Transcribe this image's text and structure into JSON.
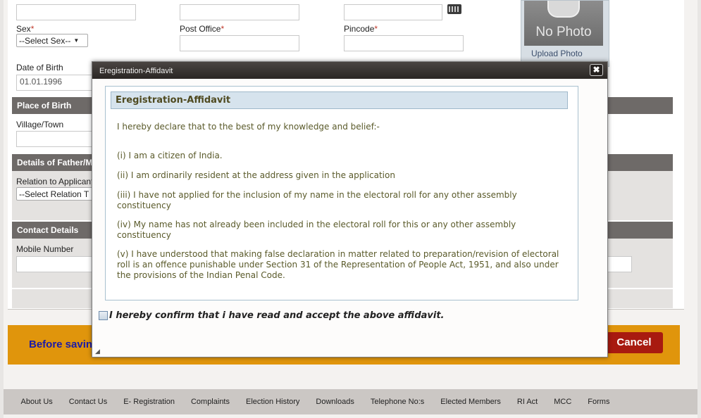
{
  "form": {
    "sex_label": "Sex",
    "sex_select": "--Select Sex--",
    "post_office_label": "Post Office",
    "pincode_label": "Pincode",
    "required_mark": "*",
    "dob_label": "Date of Birth",
    "dob_value": "01.01.1996",
    "place_of_birth_header": "Place of Birth",
    "village_label": "Village/Town",
    "details_father_header": "Details of Father/Mo",
    "relation_label": "Relation to Applicant",
    "relation_select": "--Select Relation T",
    "contact_header": "Contact Details",
    "mobile_label": "Mobile Number"
  },
  "photo": {
    "placeholder": "No Photo",
    "upload_label": "Upload Photo"
  },
  "banner": {
    "before_saving": "Before saving",
    "cancel": "Cancel"
  },
  "dialog": {
    "title": "Eregistration-Affidavit",
    "close": "✖",
    "header": "Eregistration-Affidavit",
    "intro": "I hereby declare that to the best of my knowledge and belief:-",
    "clauses": [
      "(i) I am a citizen of India.",
      "(ii) I am ordinarily resident at the address given in the application",
      "(iii) I have not applied for the inclusion of my name in the electoral roll for any other assembly constituency",
      "(iv) My name has not already been included in the electoral roll for this or any other assembly constituency",
      "(v) I have understood that making false declaration in matter related to preparation/revision of electoral roll is an offence punishable under Section 31 of the Representation of People Act, 1951, and also under the provisions of the Indian Penal Code."
    ],
    "confirm": "I hereby confirm that i have read and accept the above affidavit.",
    "resize_icon": "resize-grip-icon"
  },
  "footer": {
    "links": [
      "About Us",
      "Contact Us",
      "E- Registration",
      "Complaints",
      "Election History",
      "Downloads",
      "Telephone No:s",
      "Elected Members",
      "RI Act",
      "MCC",
      "Forms"
    ]
  },
  "colors": {
    "accent_orange": "#e0950c",
    "cancel_red": "#a81a10",
    "section_gray": "#6e6a68",
    "dialog_titlebar": "#2a2624"
  }
}
